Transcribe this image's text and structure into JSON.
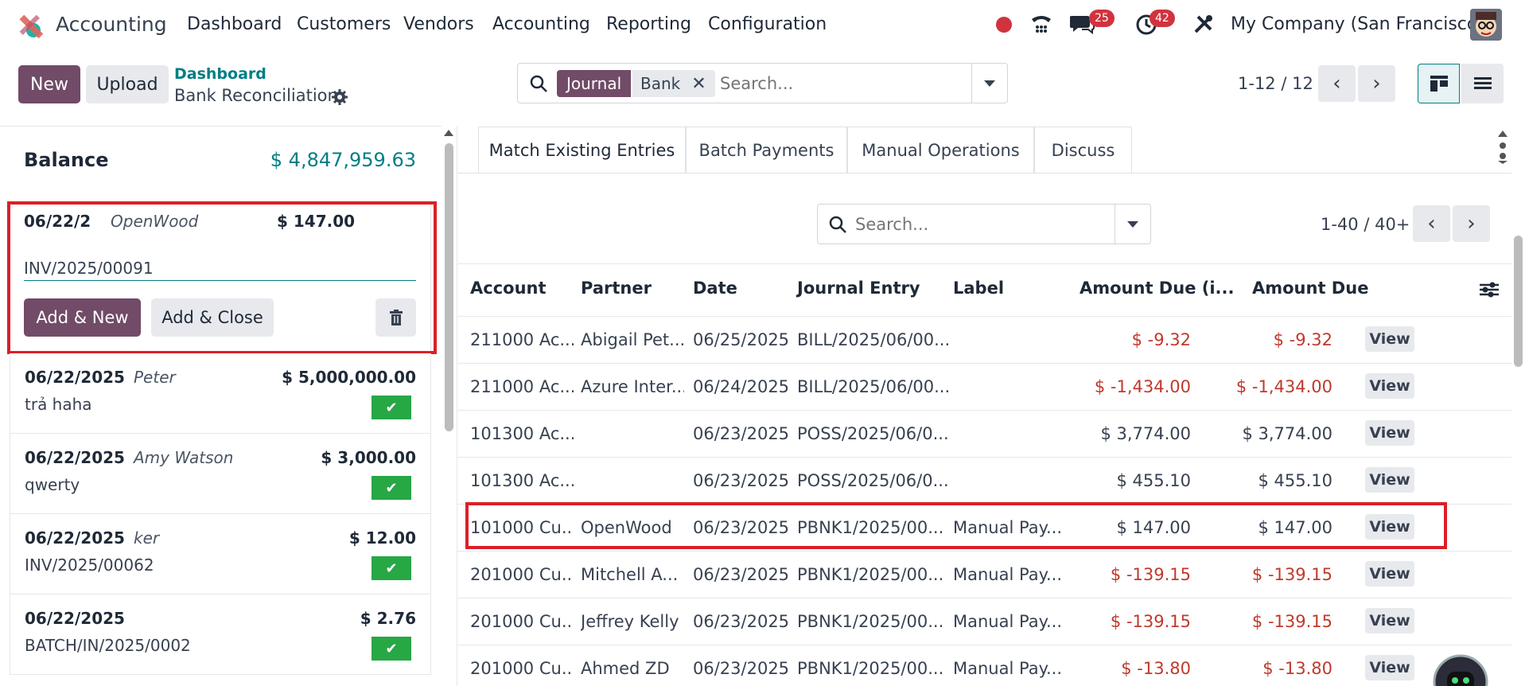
{
  "app": {
    "name": "Accounting",
    "brand_color": "#714b67"
  },
  "menu": [
    {
      "label": "Dashboard"
    },
    {
      "label": "Customers"
    },
    {
      "label": "Vendors"
    },
    {
      "label": "Accounting"
    },
    {
      "label": "Reporting"
    },
    {
      "label": "Configuration"
    }
  ],
  "systray": {
    "messages_count": "25",
    "activity_count": "42",
    "company": "My Company (San Francisco)"
  },
  "control": {
    "new_label": "New",
    "upload_label": "Upload",
    "breadcrumb_parent": "Dashboard",
    "breadcrumb_current": "Bank Reconciliation",
    "search_facet_title": "Journal",
    "search_facet_value": "Bank",
    "search_placeholder": "Search...",
    "pager": "1-12 / 12"
  },
  "balance": {
    "label": "Balance",
    "value": "$ 4,847,959.63"
  },
  "editing_statement": {
    "date": "06/22/2",
    "partner": "OpenWood",
    "amount": "$ 147.00",
    "ref": "INV/2025/00091",
    "add_new_label": "Add & New",
    "add_close_label": "Add & Close"
  },
  "statements": [
    {
      "date": "06/22/2025",
      "partner": "Peter",
      "amount": "$ 5,000,000.00",
      "label": "trả haha"
    },
    {
      "date": "06/22/2025",
      "partner": "Amy Watson",
      "amount": "$ 3,000.00",
      "label": "qwerty"
    },
    {
      "date": "06/22/2025",
      "partner": "ker",
      "amount": "$ 12.00",
      "label": "INV/2025/00062"
    },
    {
      "date": "06/22/2025",
      "partner": "",
      "amount": "$ 2.76",
      "label": "BATCH/IN/2025/0002"
    }
  ],
  "tabs": [
    {
      "label": "Match Existing Entries"
    },
    {
      "label": "Batch Payments"
    },
    {
      "label": "Manual Operations"
    },
    {
      "label": "Discuss"
    }
  ],
  "entries_search": {
    "placeholder": "Search...",
    "pager": "1-40 / 40+"
  },
  "columns": {
    "account": "Account",
    "partner": "Partner",
    "date": "Date",
    "journal_entry": "Journal Entry",
    "label": "Label",
    "amount_due_currency": "Amount Due (i...",
    "amount_due": "Amount Due"
  },
  "view_label": "View",
  "rows": [
    {
      "account": "211000 Ac...",
      "partner": "Abigail Pet...",
      "date": "06/25/2025",
      "journal_entry": "BILL/2025/06/00...",
      "label": "",
      "amount_due_currency": "$ -9.32",
      "amount_due": "$ -9.32",
      "negative": true
    },
    {
      "account": "211000 Ac...",
      "partner": "Azure Inter...",
      "date": "06/24/2025",
      "journal_entry": "BILL/2025/06/00...",
      "label": "",
      "amount_due_currency": "$ -1,434.00",
      "amount_due": "$ -1,434.00",
      "negative": true
    },
    {
      "account": "101300 Ac...",
      "partner": "",
      "date": "06/23/2025",
      "journal_entry": "POSS/2025/06/0...",
      "label": "",
      "amount_due_currency": "$ 3,774.00",
      "amount_due": "$ 3,774.00",
      "negative": false
    },
    {
      "account": "101300 Ac...",
      "partner": "",
      "date": "06/23/2025",
      "journal_entry": "POSS/2025/06/0...",
      "label": "",
      "amount_due_currency": "$ 455.10",
      "amount_due": "$ 455.10",
      "negative": false
    },
    {
      "account": "101000 Cu...",
      "partner": "OpenWood",
      "date": "06/23/2025",
      "journal_entry": "PBNK1/2025/00...",
      "label": "Manual Pay...",
      "amount_due_currency": "$ 147.00",
      "amount_due": "$ 147.00",
      "negative": false
    },
    {
      "account": "201000 Cu...",
      "partner": "Mitchell A...",
      "date": "06/23/2025",
      "journal_entry": "PBNK1/2025/00...",
      "label": "Manual Pay...",
      "amount_due_currency": "$ -139.15",
      "amount_due": "$ -139.15",
      "negative": true
    },
    {
      "account": "201000 Cu...",
      "partner": "Jeffrey Kelly",
      "date": "06/23/2025",
      "journal_entry": "PBNK1/2025/00...",
      "label": "Manual Pay...",
      "amount_due_currency": "$ -139.15",
      "amount_due": "$ -139.15",
      "negative": true
    },
    {
      "account": "201000 Cu...",
      "partner": "Ahmed ZD",
      "date": "06/23/2025",
      "journal_entry": "PBNK1/2025/00...",
      "label": "Manual Pay...",
      "amount_due_currency": "$ -13.80",
      "amount_due": "$ -13.80",
      "negative": true
    }
  ]
}
